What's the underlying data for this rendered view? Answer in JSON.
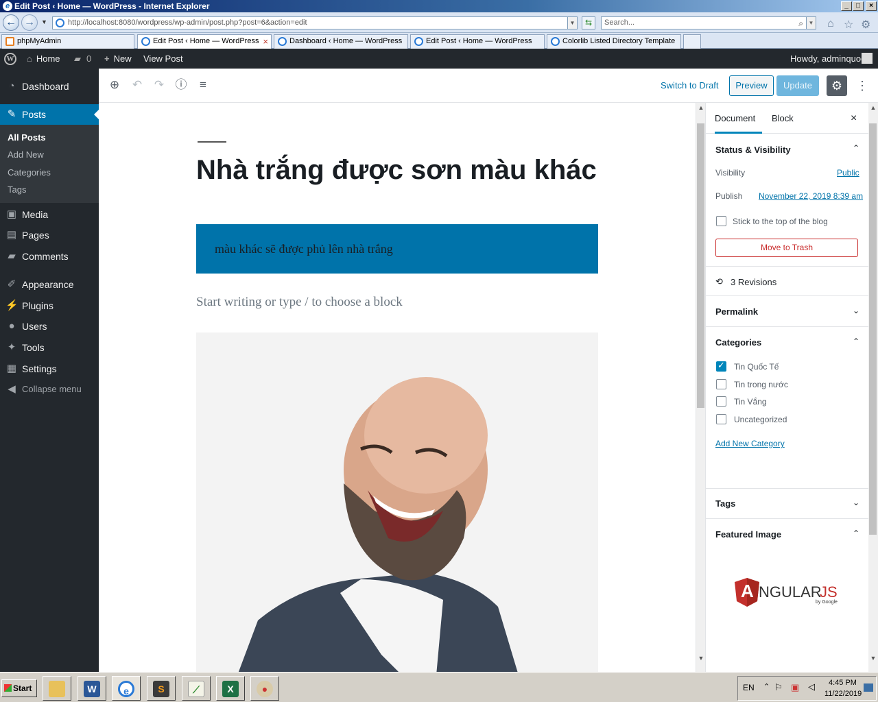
{
  "browser": {
    "title": "Edit Post ‹ Home — WordPress - Internet Explorer",
    "url": "http://localhost:8080/wordpress/wp-admin/post.php?post=6&action=edit",
    "search_placeholder": "Search...",
    "tabs": [
      {
        "label": "phpMyAdmin"
      },
      {
        "label": "Edit Post ‹ Home — WordPress"
      },
      {
        "label": "Dashboard ‹ Home — WordPress"
      },
      {
        "label": "Edit Post ‹ Home — WordPress"
      },
      {
        "label": "Colorlib Listed Directory Template"
      }
    ]
  },
  "adminbar": {
    "home": "Home",
    "comments_count": "0",
    "new": "New",
    "view_post": "View Post",
    "howdy": "Howdy, adminquoc"
  },
  "sidebar": {
    "items": [
      {
        "label": "Dashboard",
        "icon": "dashboard-icon"
      },
      {
        "label": "Posts",
        "icon": "pin-icon"
      },
      {
        "label": "Media",
        "icon": "media-icon"
      },
      {
        "label": "Pages",
        "icon": "pages-icon"
      },
      {
        "label": "Comments",
        "icon": "comment-icon"
      },
      {
        "label": "Appearance",
        "icon": "brush-icon"
      },
      {
        "label": "Plugins",
        "icon": "plug-icon"
      },
      {
        "label": "Users",
        "icon": "user-icon"
      },
      {
        "label": "Tools",
        "icon": "wrench-icon"
      },
      {
        "label": "Settings",
        "icon": "settings-icon"
      },
      {
        "label": "Collapse menu",
        "icon": "collapse-icon"
      }
    ],
    "posts_submenu": [
      "All Posts",
      "Add New",
      "Categories",
      "Tags"
    ]
  },
  "editor": {
    "switch_to_draft": "Switch to Draft",
    "preview": "Preview",
    "update": "Update",
    "post_title": "Nhà trắng được sơn màu khác",
    "cover_text": "màu khác sẽ được phủ lên nhà trắng",
    "block_placeholder": "Start writing or type / to choose a block"
  },
  "settings_panel": {
    "tabs": [
      "Document",
      "Block"
    ],
    "status_visibility": {
      "heading": "Status & Visibility",
      "visibility_label": "Visibility",
      "visibility_value": "Public",
      "publish_label": "Publish",
      "publish_value": "November 22, 2019 8:39 am",
      "sticky_label": "Stick to the top of the blog",
      "trash": "Move to Trash"
    },
    "revisions": "3 Revisions",
    "permalink": "Permalink",
    "categories": {
      "heading": "Categories",
      "items": [
        {
          "label": "Tin Quốc Tế",
          "checked": true
        },
        {
          "label": "Tin trong nước",
          "checked": false
        },
        {
          "label": "Tin Vắng",
          "checked": false
        },
        {
          "label": "Uncategorized",
          "checked": false
        }
      ],
      "add_new": "Add New Category"
    },
    "tags": "Tags",
    "featured_image": "Featured Image",
    "featured_logo_text": "NGULAR",
    "featured_logo_letter": "A",
    "featured_logo_suffix": "JS",
    "featured_logo_by": "by Google"
  },
  "taskbar": {
    "start": "Start",
    "lang": "EN",
    "time": "4:45 PM",
    "date": "11/22/2019"
  },
  "colors": {
    "wp_blue": "#0073aa",
    "admin_dark": "#23282d",
    "trash_red": "#c92c2c"
  }
}
